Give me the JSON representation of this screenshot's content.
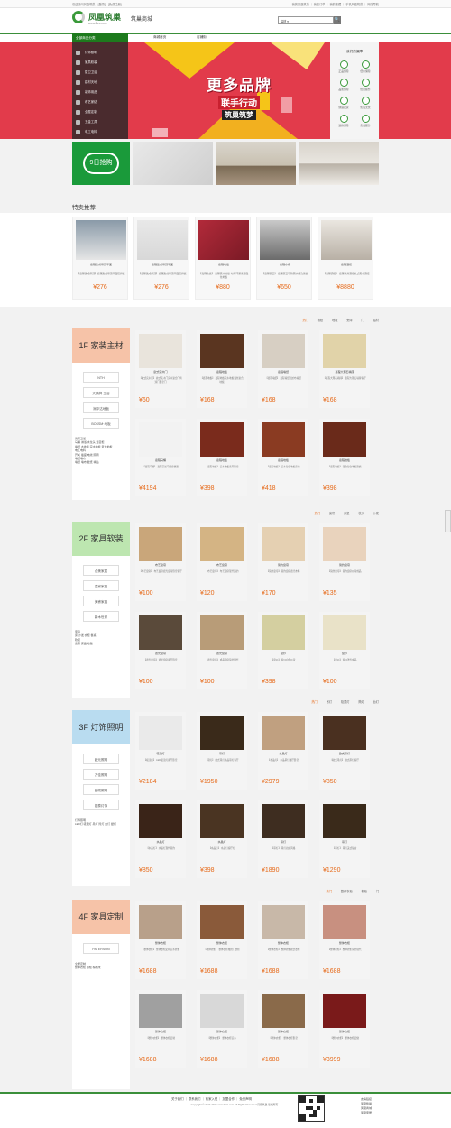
{
  "topbar": {
    "left": "欢迎访问凤凰筑巢　[登录]　[免费注册]",
    "right": "我的凤凰筑巢 ｜ 我的订单 ｜ 我的收藏 ｜ 手机凤凰筑巢 ｜ 网站导航"
  },
  "header": {
    "logo": "凤凰筑巢",
    "logo_sub": "www.fhzc.com",
    "site_name": "筑巢商城",
    "search_select": "建材 ▾",
    "search_btn": "🔍"
  },
  "nav": {
    "cat_label": "全部商品分类",
    "links": [
      "商城首页",
      "店铺街"
    ]
  },
  "categories": [
    "灯饰照明",
    "家具软装",
    "厨卫卫浴",
    "建材天地",
    "装饰用品",
    "布艺家纺",
    "全屋定制",
    "五金工具",
    "电工电料"
  ],
  "banner": {
    "line1": "更多品牌",
    "line2": "联手行动",
    "line3": "筑巢筑梦"
  },
  "services": {
    "title": "我们的保障",
    "items": [
      "正品保障",
      "低价保障",
      "品质保障",
      "优质服务",
      "快速发货",
      "售后无忧",
      "退换保障",
      "售后服务"
    ]
  },
  "promo": {
    "first": "9日抢购"
  },
  "sale": {
    "title": "特卖推荐",
    "items": [
      {
        "name": "嘉程集成吊顶平面",
        "desc": "【嘉程集成吊顶】嘉程集成吊顶平面铝扣板",
        "price": "¥276"
      },
      {
        "name": "嘉程集成吊顶平面",
        "desc": "【嘉程集成吊顶】嘉程集成吊顶平面铝扣板",
        "price": "¥276"
      },
      {
        "name": "嘉程地板",
        "desc": "【嘉程地板】 嘉程实木地板 时尚环保家用强化地板",
        "price": "¥880"
      },
      {
        "name": "嘉程水槽",
        "desc": "【嘉程厨卫】 嘉程厨卫不锈钢水槽洗菜盆",
        "price": "¥650"
      },
      {
        "name": "嘉程酒柜",
        "desc": "【嘉程酒柜】 嘉程家具酒柜欧式实木酒柜",
        "price": "¥8880"
      }
    ]
  },
  "floors": [
    {
      "title": "1F 家装主材",
      "tabs": [
        "热门",
        "墙纸",
        "地板",
        "瓷砖",
        "门",
        "铝材"
      ],
      "brands": [
        "NTH",
        "天鹅牌·卫浴",
        "润华达地板",
        "BOSSM·地板"
      ],
      "subs": "瓷砖卫浴\n马桶 淋浴 水龙头 浴室柜\n墙纸 木地板 实木地板 复合地板\n电工电料\n开关 插座 电线 照明\n墙纸墙布\n墙纸 墙布 壁纸 墙贴\n",
      "items": [
        {
          "name": "欧式实木门",
          "desc": "【欧式实木门】 欧式实木门实木复合门烤漆门卧室门",
          "price": "¥60"
        },
        {
          "name": "嘉程地板",
          "desc": "【嘉程地板】 嘉程地板实木地板强化复合地板",
          "price": "¥168"
        },
        {
          "name": "嘉程墙纸",
          "desc": "【嘉程墙纸】 嘉程墙纸无纺布墙纸",
          "price": "¥168"
        },
        {
          "name": "嘉程大理石墙砖",
          "desc": "【嘉程大理石墙砖】 嘉程大理石墙砖客厅",
          "price": "¥168"
        },
        {
          "name": "嘉程马桶",
          "desc": "【嘉程马桶】 嘉程卫浴马桶座便器",
          "price": "¥4194"
        },
        {
          "name": "嘉程地板",
          "desc": "【嘉程地板】 实木地板客厅卧室",
          "price": "¥398"
        },
        {
          "name": "嘉程地板",
          "desc": "【嘉程地板】 实木复合地板家用",
          "price": "¥418"
        },
        {
          "name": "嘉程地板",
          "desc": "【嘉程地板】 强化复合地板耐磨",
          "price": "¥398"
        }
      ]
    },
    {
      "title": "2F 家具软装",
      "tabs": [
        "热门",
        "窗帘",
        "床垫",
        "枕头",
        "沙发"
      ],
      "brands": [
        "合美家居",
        "皇家家具",
        "美睿家具",
        "新木世家"
      ],
      "subs": "家具\n床 沙发 衣柜 餐桌\n软装\n窗帘 床品 地毯\n",
      "items": [
        {
          "name": "布艺窗帘",
          "desc": "【布艺窗帘】 布艺窗帘遮光窗帘卧室客厅",
          "price": "¥100"
        },
        {
          "name": "布艺窗帘",
          "desc": "【布艺窗帘】 布艺窗帘现代简约",
          "price": "¥120"
        },
        {
          "name": "简约窗帘",
          "desc": "【简约窗帘】 简约窗帘遮光布料",
          "price": "¥170"
        },
        {
          "name": "简约窗帘",
          "desc": "【简约窗帘】 简约窗帘纱帘成品",
          "price": "¥135"
        },
        {
          "name": "遮光窗帘",
          "desc": "【遮光窗帘】 遮光窗帘客厅卧室",
          "price": "¥100"
        },
        {
          "name": "遮光窗帘",
          "desc": "【遮光窗帘】 成品窗帘简约现代",
          "price": "¥100"
        },
        {
          "name": "窗纱",
          "desc": "【窗纱】 窗纱白色纱帘",
          "price": "¥398"
        },
        {
          "name": "窗纱",
          "desc": "【窗纱】 窗纱透光成品",
          "price": "¥100"
        }
      ]
    },
    {
      "title": "3F 灯饰照明",
      "tabs": [
        "热门",
        "吊灯",
        "吸顶灯",
        "筒灯",
        "台灯"
      ],
      "brands": [
        "欧元照明",
        "万佳照明",
        "欧瑞照明",
        "银泰灯饰"
      ],
      "subs": "灯饰照明\nLED灯 吸顶灯 吊灯 筒灯 台灯 壁灯\n",
      "items": [
        {
          "name": "吸顶灯",
          "desc": "【吸顶灯】 LED吸顶灯客厅卧室",
          "price": "¥2184"
        },
        {
          "name": "吊灯",
          "desc": "【吊灯】 欧式吊灯水晶吊灯客厅",
          "price": "¥1950"
        },
        {
          "name": "水晶灯",
          "desc": "【水晶灯】 水晶吊灯餐厅卧室",
          "price": "¥2979"
        },
        {
          "name": "欧式吊灯",
          "desc": "【欧式吊灯】 欧式吊灯客厅",
          "price": "¥850"
        },
        {
          "name": "水晶灯",
          "desc": "【水晶灯】 水晶灯现代简约",
          "price": "¥850"
        },
        {
          "name": "水晶灯",
          "desc": "【水晶灯】 水晶灯客厅灯",
          "price": "¥398"
        },
        {
          "name": "吊灯",
          "desc": "【吊灯】 吊灯北欧风格",
          "price": "¥1890"
        },
        {
          "name": "吊灯",
          "desc": "【吊灯】 吊灯美式复古",
          "price": "¥1290"
        }
      ]
    },
    {
      "title": "4F 家具定制",
      "tabs": [
        "热门",
        "整体衣柜",
        "橱柜",
        "门"
      ],
      "brands": [
        "PATERSON"
      ],
      "subs": "全屋定制\n整体衣柜 橱柜 榻榻米\n",
      "items": [
        {
          "name": "整体衣柜",
          "desc": "【整体衣柜】 整体衣柜定制实木衣柜",
          "price": "¥1688"
        },
        {
          "name": "整体衣柜",
          "desc": "【整体衣柜】 整体衣柜推拉门衣柜",
          "price": "¥1688"
        },
        {
          "name": "整体衣柜",
          "desc": "【整体衣柜】 整体衣柜欧式衣柜",
          "price": "¥1688"
        },
        {
          "name": "整体衣柜",
          "desc": "【整体衣柜】 整体衣柜简约现代",
          "price": "¥1688"
        },
        {
          "name": "整体衣柜",
          "desc": "【整体衣柜】 整体衣柜定制",
          "price": "¥1688"
        },
        {
          "name": "整体衣柜",
          "desc": "【整体衣柜】 整体衣柜实木",
          "price": "¥1688"
        },
        {
          "name": "整体衣柜",
          "desc": "【整体衣柜】 整体衣柜卧室",
          "price": "¥1688"
        },
        {
          "name": "整体衣柜",
          "desc": "【整体衣柜】 整体衣柜定做",
          "price": "¥3999"
        }
      ]
    }
  ],
  "footer": {
    "links": "关于我们 ｜ 联系我们 ｜ 商家入驻 ｜ 加盟合作 ｜ 免责声明",
    "copy": "Copyright © 2014-2015 www.fhzc.com All Rights Reserved 凤凰筑巢 版权所有",
    "right": "友情链接\n凤凰筑巢\n凤凰商城\n凤凰家居"
  }
}
